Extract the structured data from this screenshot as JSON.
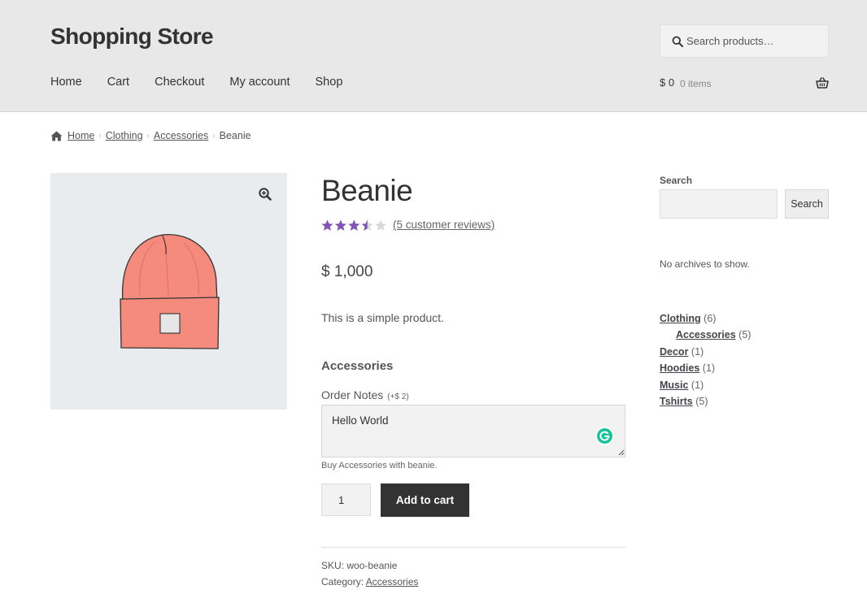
{
  "header": {
    "site_title": "Shopping Store",
    "search_placeholder": "Search products…",
    "nav": [
      "Home",
      "Cart",
      "Checkout",
      "My account",
      "Shop"
    ],
    "cart_total": "$ 0",
    "cart_items": "0 items"
  },
  "breadcrumb": {
    "home": "Home",
    "clothing": "Clothing",
    "accessories": "Accessories",
    "current": "Beanie"
  },
  "product": {
    "title": "Beanie",
    "rating": 3.5,
    "rating_max": 5,
    "reviews_label": "(5 customer reviews)",
    "price": "$ 1,000",
    "short_description": "This is a simple product.",
    "addons_heading": "Accessories",
    "notes_label": "Order Notes",
    "notes_price": "(+$ 2)",
    "notes_value": "Hello World",
    "notes_helper": "Buy Accessories with beanie.",
    "quantity": "1",
    "add_to_cart_label": "Add to cart",
    "sku_label": "SKU:",
    "sku_value": "woo-beanie",
    "category_label": "Category:",
    "category_value": "Accessories"
  },
  "sidebar": {
    "search_label": "Search",
    "search_button": "Search",
    "no_archives": "No archives to show.",
    "categories": [
      {
        "name": "Clothing",
        "count": "(6)",
        "sub": false
      },
      {
        "name": "Accessories",
        "count": "(5)",
        "sub": true
      },
      {
        "name": "Decor",
        "count": "(1)",
        "sub": false
      },
      {
        "name": "Hoodies",
        "count": "(1)",
        "sub": false
      },
      {
        "name": "Music",
        "count": "(1)",
        "sub": false
      },
      {
        "name": "Tshirts",
        "count": "(5)",
        "sub": false
      }
    ]
  },
  "colors": {
    "header_bg": "#e8e8e8",
    "star_color": "#7f54b3",
    "button_dark": "#333333",
    "image_bg": "#e9ecef",
    "grammarly": "#15c39a"
  },
  "icons": [
    "search-icon",
    "basket-icon",
    "home-icon",
    "zoom-icon",
    "grammarly-icon",
    "star-icon"
  ]
}
